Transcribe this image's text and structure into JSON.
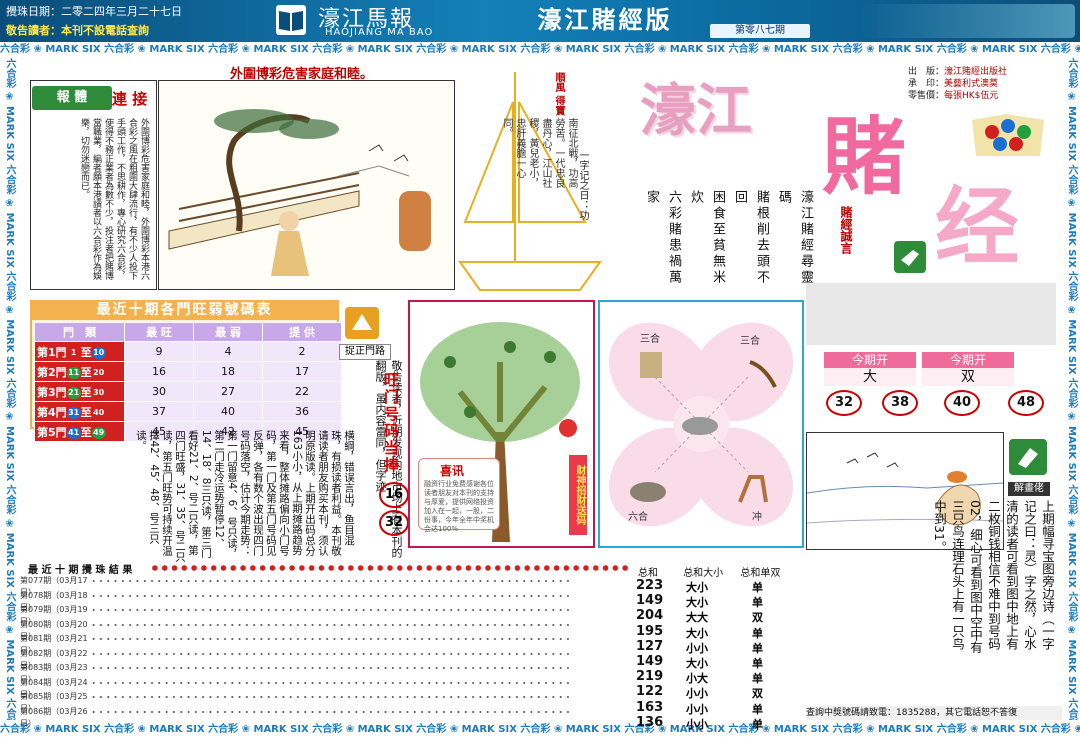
{
  "header": {
    "issue_date": "攪珠日期：二零二四年三月二十七日",
    "reader_note": "敬告讀者：本刊不設電話查詢",
    "brand_cn": "濠江馬報",
    "brand_en": "HAOJIANG MA BAO",
    "edition_title": "濠江賭經版",
    "issue_no": "第零八七期"
  },
  "border_text": "六合彩 ❀ MARK SIX 六合彩 ❀ MARK SIX 六合彩 ❀ MARK SIX 六合彩 ❀ MARK SIX 六合彩 ❀ MARK SIX 六合彩 ❀ MARK SIX 六合彩 ❀ MARK SIX 六合彩 ❀ MARK SIX 六合彩 ❀ MARK SIX 六合彩 ❀ MARK SIX 六合彩 ❀ MARK SIX",
  "article": {
    "badge": "報 體",
    "tag": "連 接",
    "body": "外圍博彩危害家庭和睦，外圍博彩本港六合彩之風在粗圍大肆流行，有不少人投下手頭工作，不思耕作，專心研究六合彩，使得不務正業者為數不少，投注者把賭博當職業，編者願本港讀者以六合彩作為娛樂，切勿迷戀而已。",
    "illus_caption": "外圍博彩危害家庭和睦。"
  },
  "poem": {
    "flag": "順風\n得寶",
    "lines": "南征北戰，功高勞苦。一代忠良盡丹心，江山社稷，黃兒老小，忠肝義膽一心同。",
    "proverb": "一字记之日：功"
  },
  "title": {
    "jiang": "濠江",
    "du": "賭",
    "jing": "经",
    "motto_title": "賭經誠言",
    "motto_lines": [
      "六彩賭患禍萬家",
      "困食至貧無米炊",
      "賭根削去頭不回",
      "濠江賭經尋靈碼"
    ]
  },
  "publisher": {
    "publisher_label": "出　版：",
    "publisher_value": "濠江賭經出版社",
    "printer_label": "承　印：",
    "printer_value": "美藝利式澳莫",
    "price_label": "零售價：",
    "price_value": "每張HK$伍元"
  },
  "period": {
    "label1": "今期开",
    "value1": "大",
    "label2": "今期开",
    "value2": "双",
    "numbers": [
      "32",
      "38",
      "40",
      "48"
    ]
  },
  "hot_table": {
    "title": "最近十期各門旺弱號碼表",
    "headers": [
      "門　類",
      "最 旺",
      "最 弱",
      "提 供"
    ],
    "rows": [
      {
        "gate": "第1門",
        "from": "1",
        "to": "10",
        "hot": "9",
        "weak": "4",
        "provide": "2"
      },
      {
        "gate": "第2門",
        "from": "11",
        "to": "20",
        "hot": "16",
        "weak": "18",
        "provide": "17"
      },
      {
        "gate": "第3門",
        "from": "21",
        "to": "30",
        "hot": "30",
        "weak": "27",
        "provide": "22"
      },
      {
        "gate": "第4門",
        "from": "31",
        "to": "40",
        "hot": "37",
        "weak": "40",
        "provide": "36"
      },
      {
        "gate": "第5門",
        "from": "41",
        "to": "49",
        "hot": "45",
        "weak": "42",
        "provide": "45"
      }
    ],
    "to_word": "至"
  },
  "gate_label": "捉正門路",
  "gate_text": "横綱，错误言出，鱼目混珠，有损读者利益。本刊敬请读者朋友购买本刊，须认明原版读。上期开出码总分163小小，从上期摊路趋势来看，整体摊路偏向小门号码，第一门及第五门号码见反弹，各有数个波出现四门号码落空，估计今期走势：第一门留意4、6、号只读，第二门走冷运势暂停12、14、18、8三只读，第三门看好21、2、号二只读，第四门旺盛，31、35、号二只读，第五门旺势可持续开温擇42、45、48、号三只读。",
  "hint_text": "敬告读者，近期发现内地市场上有本刊的翻版，虽内容雷同，但字迹",
  "wang": {
    "title": "旺门号码当捧",
    "n1": "16",
    "n2": "32"
  },
  "tree": {
    "side_label": "财神招财送码",
    "riddle_title": "喜讯",
    "riddle_text": "融资行业免费感谢各位读者朋友对本刊的支持与厚爱，提供网络投资加入在一起，一股，二份事，今年全年中奖机会达100%"
  },
  "zodiac": {
    "sanhe1": "三合",
    "sanhe2": "三合",
    "liuhe": "六合",
    "chong": "冲"
  },
  "solve": {
    "label": "解畫佬",
    "text": "上期幅寻宝图旁边诗（一字记之曰：灵）字之然，心水清的读者可看到图中地上有二枚铜钱相信不难中到号码02，细心可看到图中空中有三只鸟连理石头上有一只鸟中到31。"
  },
  "contact": "查詢中獎號碼請致電：1835288，其它電話恕不答復",
  "draw_history": {
    "title": "最 近 十 期 攪 珠 結 果",
    "rows": [
      "第077期（03月17日）",
      "第078期（03月18日）",
      "第079期（03月19日）",
      "第080期（03月20日）",
      "第081期（03月21日）",
      "第082期（03月22日）",
      "第083期（03月23日）",
      "第084期（03月24日）",
      "第085期（03月25日）",
      "第086期（03月26日）"
    ],
    "sum_header": "总和",
    "bigsmall_header": "总和大小",
    "oddeven_header": "总和单双",
    "sums": [
      "223",
      "149",
      "204",
      "195",
      "127",
      "149",
      "219",
      "122",
      "163",
      "136"
    ],
    "bigsmall": [
      "大小",
      "大小",
      "大大",
      "大小",
      "小小",
      "大小",
      "小大",
      "小小",
      "小小",
      "小小"
    ],
    "oddeven": [
      "单",
      "单",
      "双",
      "单",
      "单",
      "单",
      "单",
      "双",
      "单",
      "单"
    ]
  },
  "colors": {
    "header_blue": "#1380b8",
    "accent_red": "#d00000",
    "pink_title": "#f06aa0",
    "table_orange": "#f3b24d",
    "zodiac_frame": "#2aa8d8"
  }
}
